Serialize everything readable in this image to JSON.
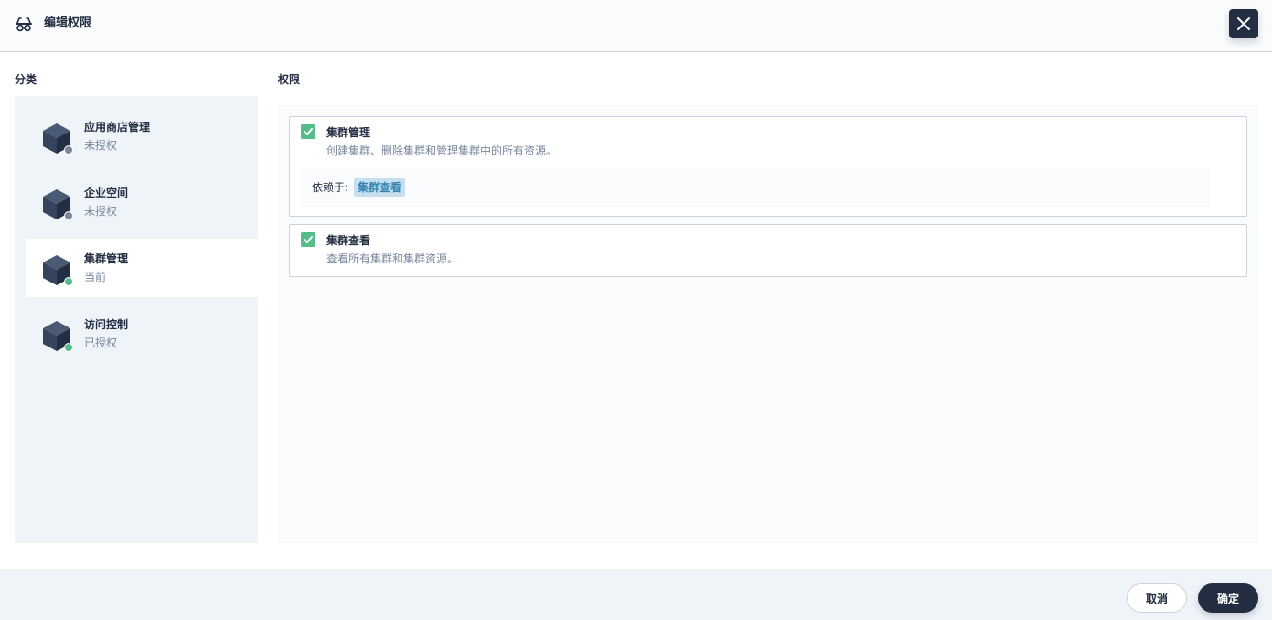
{
  "header": {
    "title": "编辑权限",
    "icon": "glasses-icon"
  },
  "categories": {
    "title": "分类",
    "items": [
      {
        "name": "应用商店管理",
        "status": "未授权",
        "status_color": "#79879c"
      },
      {
        "name": "企业空间",
        "status": "未授权",
        "status_color": "#79879c"
      },
      {
        "name": "集群管理",
        "status": "当前",
        "status_color": "#55bc8a",
        "active": true
      },
      {
        "name": "访问控制",
        "status": "已授权",
        "status_color": "#55bc8a"
      }
    ]
  },
  "permissions": {
    "title": "权限",
    "items": [
      {
        "name": "集群管理",
        "checked": true,
        "description": "创建集群、删除集群和管理集群中的所有资源。",
        "depends_label": "依赖于:",
        "depends_on": "集群查看"
      },
      {
        "name": "集群查看",
        "checked": true,
        "description": "查看所有集群和集群资源。"
      }
    ]
  },
  "footer": {
    "cancel_label": "取消",
    "ok_label": "确定"
  },
  "colors": {
    "primary": "#242e42",
    "success": "#55bc8a",
    "muted": "#79879c",
    "tag_bg": "#c7deef"
  }
}
